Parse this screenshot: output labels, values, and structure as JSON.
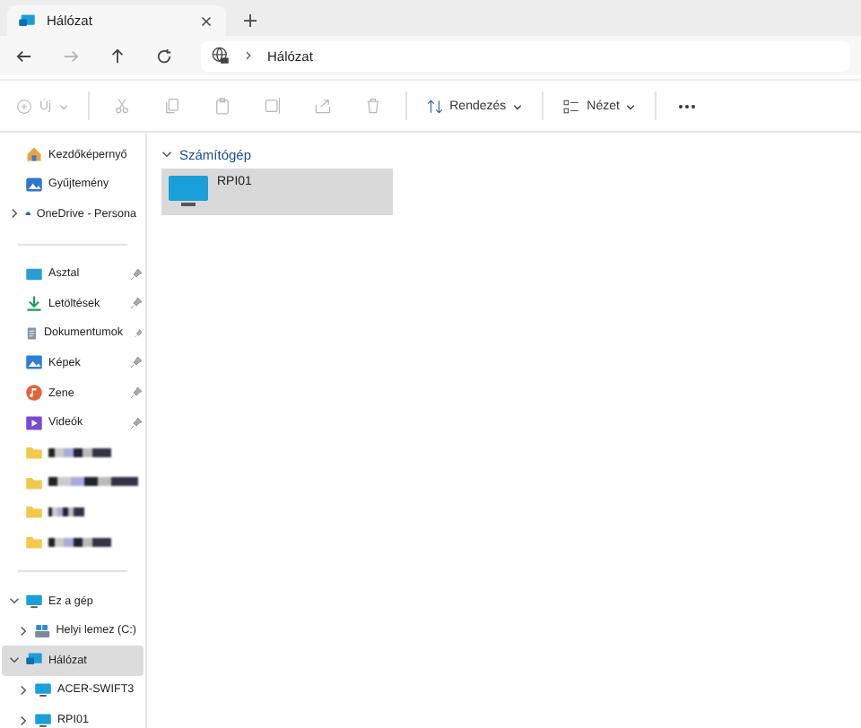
{
  "tab": {
    "title": "Hálózat"
  },
  "address": {
    "path": "Hálózat"
  },
  "toolbar": {
    "new_label": "Új",
    "new_disabled": true,
    "actions": [
      {
        "kind": "cut",
        "disabled": true
      },
      {
        "kind": "copy",
        "disabled": true
      },
      {
        "kind": "paste",
        "disabled": true
      },
      {
        "kind": "rename",
        "disabled": true
      },
      {
        "kind": "share",
        "disabled": true
      },
      {
        "kind": "delete",
        "disabled": true
      }
    ],
    "sort_label": "Rendezés",
    "view_label": "Nézet"
  },
  "sidebar": {
    "items": [
      {
        "kind": "item",
        "label": "Kezdőképernyő",
        "selected": false
      },
      {
        "kind": "item",
        "label": "Gyűjtemény",
        "selected": false
      },
      {
        "kind": "item",
        "label": "OneDrive - Persona",
        "expanded": false,
        "selected": false
      },
      {
        "kind": "divider"
      },
      {
        "kind": "item",
        "label": "Asztal",
        "pinned": true,
        "selected": false
      },
      {
        "kind": "item",
        "label": "Letöltések",
        "pinned": true,
        "selected": false
      },
      {
        "kind": "item",
        "label": "Dokumentumok",
        "pinned": true,
        "selected": false
      },
      {
        "kind": "item",
        "label": "Képek",
        "pinned": true,
        "selected": false
      },
      {
        "kind": "item",
        "label": "Zene",
        "pinned": true,
        "selected": false
      },
      {
        "kind": "item",
        "label": "Videók",
        "pinned": true,
        "selected": false
      },
      {
        "kind": "redacted"
      },
      {
        "kind": "redacted"
      },
      {
        "kind": "redacted"
      },
      {
        "kind": "redacted"
      },
      {
        "kind": "divider"
      },
      {
        "kind": "item",
        "label": "Ez a gép",
        "expanded": true,
        "selected": false,
        "children": [
          {
            "kind": "item",
            "label": "Helyi lemez (C:)",
            "expanded": false,
            "selected": false
          }
        ]
      },
      {
        "kind": "item",
        "label": "Hálózat",
        "expanded": true,
        "selected": true,
        "children": [
          {
            "kind": "item",
            "label": "ACER-SWIFT3",
            "expanded": false,
            "selected": false
          },
          {
            "kind": "item",
            "label": "RPI01",
            "expanded": false,
            "selected": false
          }
        ]
      }
    ]
  },
  "content": {
    "groups": [
      {
        "title": "Számítógép",
        "expanded": true,
        "items": [
          {
            "label": "RPI01",
            "selected": true
          }
        ]
      }
    ]
  }
}
